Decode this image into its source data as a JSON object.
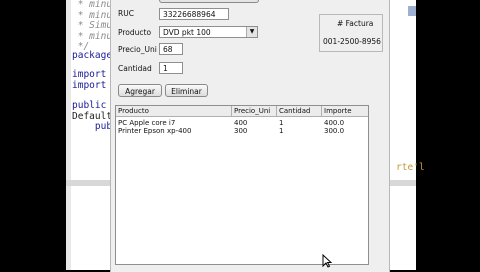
{
  "editor": {
    "lines": [
      {
        "text": " * minu",
        "kind": "comment"
      },
      {
        "text": " * Simu",
        "kind": "comment"
      },
      {
        "text": " * minu",
        "kind": "comment"
      },
      {
        "text": " */",
        "kind": "comment"
      },
      {
        "text": "package",
        "kind": "kw"
      },
      {
        "text": "import",
        "kind": "kw"
      },
      {
        "text": "import",
        "kind": "kw"
      },
      {
        "text": "public",
        "kind": "kw"
      },
      {
        "text": "Default",
        "kind": "code"
      },
      {
        "text": "    pub",
        "kind": "kw"
      }
    ],
    "right_fragment": "rte'l"
  },
  "form": {
    "ruc_label": "RUC",
    "ruc_value": "33226688964",
    "producto_label": "Producto",
    "producto_value": "DVD pkt 100",
    "precio_label": "Precio_Uni",
    "precio_value": "68",
    "cantidad_label": "Cantidad",
    "cantidad_value": "1",
    "agregar_button": "Agregar",
    "eliminar_button": "Eliminar",
    "factura_label": "# Factura",
    "factura_value": "001-2500-8956"
  },
  "table": {
    "headers": [
      "Producto",
      "Precio_Uni",
      "Cantidad",
      "Importe"
    ],
    "rows": [
      [
        "PC Apple core i7",
        "400",
        "1",
        "400.0"
      ],
      [
        "Printer Epson xp-400",
        "300",
        "1",
        "300.0"
      ]
    ]
  }
}
